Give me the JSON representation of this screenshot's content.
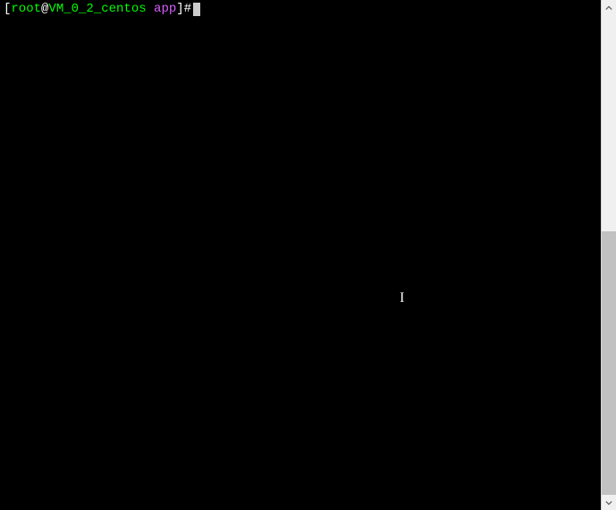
{
  "prompt": {
    "open_bracket": "[",
    "user": "root",
    "at": "@",
    "host": "VM_0_2_centos",
    "space": " ",
    "dir": "app",
    "close_bracket": "]",
    "symbol": "#"
  },
  "cursor_glyph": "I"
}
